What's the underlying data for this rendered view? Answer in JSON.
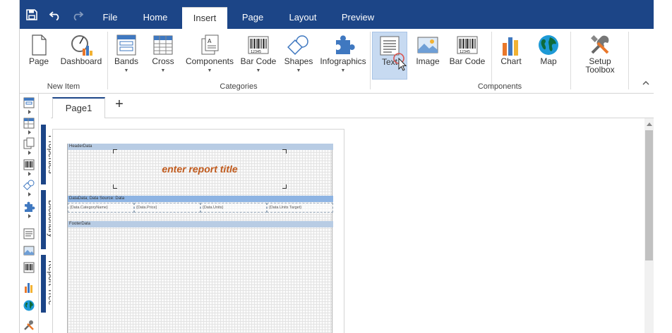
{
  "menu": {
    "tabs": [
      {
        "label": "File"
      },
      {
        "label": "Home"
      },
      {
        "label": "Insert"
      },
      {
        "label": "Page"
      },
      {
        "label": "Layout"
      },
      {
        "label": "Preview"
      }
    ],
    "active_tab": "Insert"
  },
  "ribbon": {
    "groups": [
      {
        "label": "New Item"
      },
      {
        "label": "Categories"
      },
      {
        "label": "Components"
      }
    ],
    "buttons": {
      "page": "Page",
      "dashboard": "Dashboard",
      "bands": "Bands",
      "cross": "Cross",
      "components": "Components",
      "barcode_cat": "Bar Code",
      "shapes": "Shapes",
      "infographics": "Infographics",
      "text": "Text",
      "image": "Image",
      "barcode": "Bar Code",
      "chart": "Chart",
      "map": "Map",
      "setup_toolbox": "Setup Toolbox"
    },
    "dropdown_glyph": "▼"
  },
  "side_panels": {
    "properties": "Properties",
    "dictionary": "Dictionary",
    "report_tree": "Report Tree"
  },
  "page_tabs": {
    "tabs": [
      {
        "label": "Page1"
      }
    ],
    "add_glyph": "+"
  },
  "report": {
    "header_band": "HeaderData",
    "title": "enter report title",
    "data_band": "DataData; Data Source: Data",
    "cells": [
      "{Data.CategoryName}",
      "{Data.Price}",
      "{Data.Units}",
      "{Data.Units Target}"
    ],
    "footer_band": "FooterData"
  },
  "colors": {
    "accent": "#1c4587",
    "selected": "#c7daf1",
    "title_text": "#c05a1c"
  }
}
